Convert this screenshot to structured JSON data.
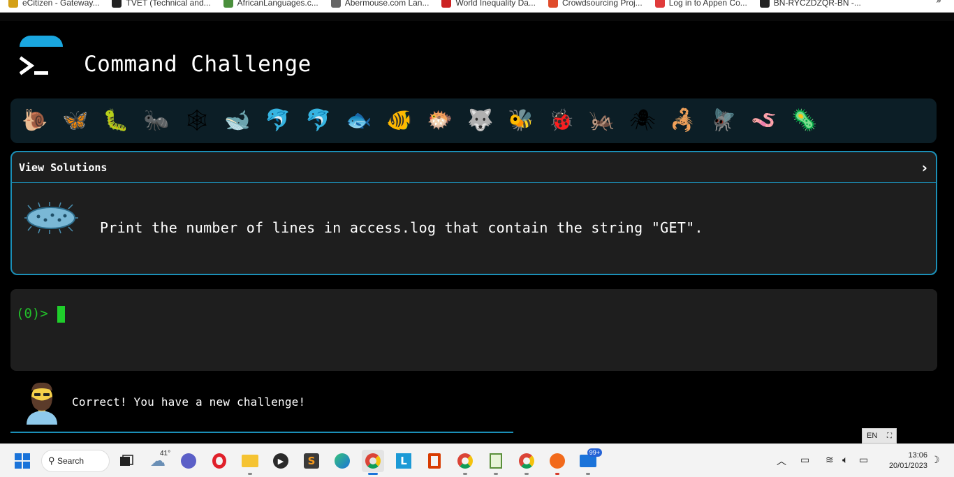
{
  "bookmarks": [
    {
      "label": "eCitizen - Gateway...",
      "color": "#d4a017"
    },
    {
      "label": "TVET (Technical and...",
      "color": "#222222"
    },
    {
      "label": "AfricanLanguages.c...",
      "color": "#4a8f3c"
    },
    {
      "label": "Abermouse.com Lan...",
      "color": "#666666"
    },
    {
      "label": "World Inequality Da...",
      "color": "#cc2222"
    },
    {
      "label": "Crowdsourcing Proj...",
      "color": "#e04b2a"
    },
    {
      "label": "Log in to Appen Co...",
      "color": "#e03a3a"
    },
    {
      "label": "BN-RYCZDZQR-BN -...",
      "color": "#222222"
    }
  ],
  "bookmarks_more": "»",
  "header": {
    "title": "Command Challenge"
  },
  "critters": [
    "🐌",
    "🦋",
    "🐛",
    "🐜",
    "🕸",
    "🐋",
    "🐬",
    "🐬",
    "🐟",
    "🐠",
    "🐡",
    "🐺",
    "🐝",
    "🐞",
    "🦗",
    "🕷",
    "🦂",
    "🪰",
    "🪱",
    "🦠"
  ],
  "challenge": {
    "solutions_label": "View Solutions",
    "chevron": "›",
    "text": "Print the number of lines in access.log that contain the string \"GET\"."
  },
  "terminal": {
    "prompt": "(0)>"
  },
  "feedback": {
    "message": "Correct! You have a new challenge!"
  },
  "ime": {
    "label": "EN"
  },
  "taskbar": {
    "search_label": "Search",
    "weather_temp": "41°",
    "mail_badge": "99+",
    "clock_time": "13:06",
    "clock_date": "20/01/2023"
  },
  "colors": {
    "accent": "#1b8fb7",
    "prompt_green": "#22c02a",
    "card_bg": "#1e1e1e"
  }
}
